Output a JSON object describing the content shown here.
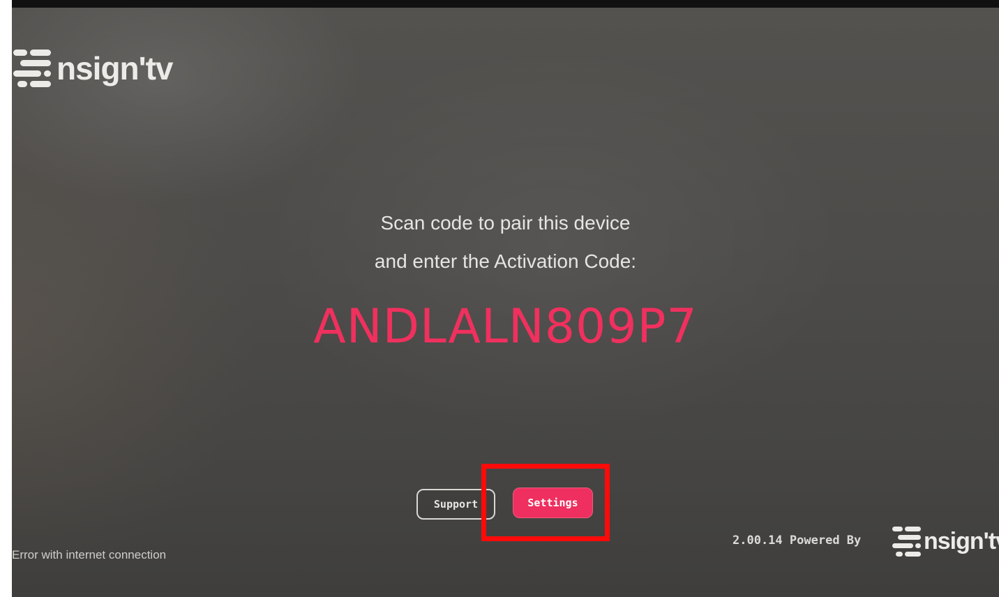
{
  "brand": {
    "logo_text": "nsign'tv"
  },
  "main": {
    "prompt_line1": "Scan code to pair this device",
    "prompt_line2": "and enter the Activation Code:",
    "activation_code": "ANDLALN809P7"
  },
  "buttons": {
    "support_label": "Support",
    "settings_label": "Settings"
  },
  "footer": {
    "status": "Error with internet connection",
    "version": "2.00.14",
    "powered_by": "Powered By",
    "logo_text": "nsign'tv"
  },
  "colors": {
    "accent": "#ee2f5f",
    "background": "#4c4b49",
    "highlight": "#ff0a0a"
  },
  "icons": {
    "brand_mark": "nsign-logo-icon"
  }
}
